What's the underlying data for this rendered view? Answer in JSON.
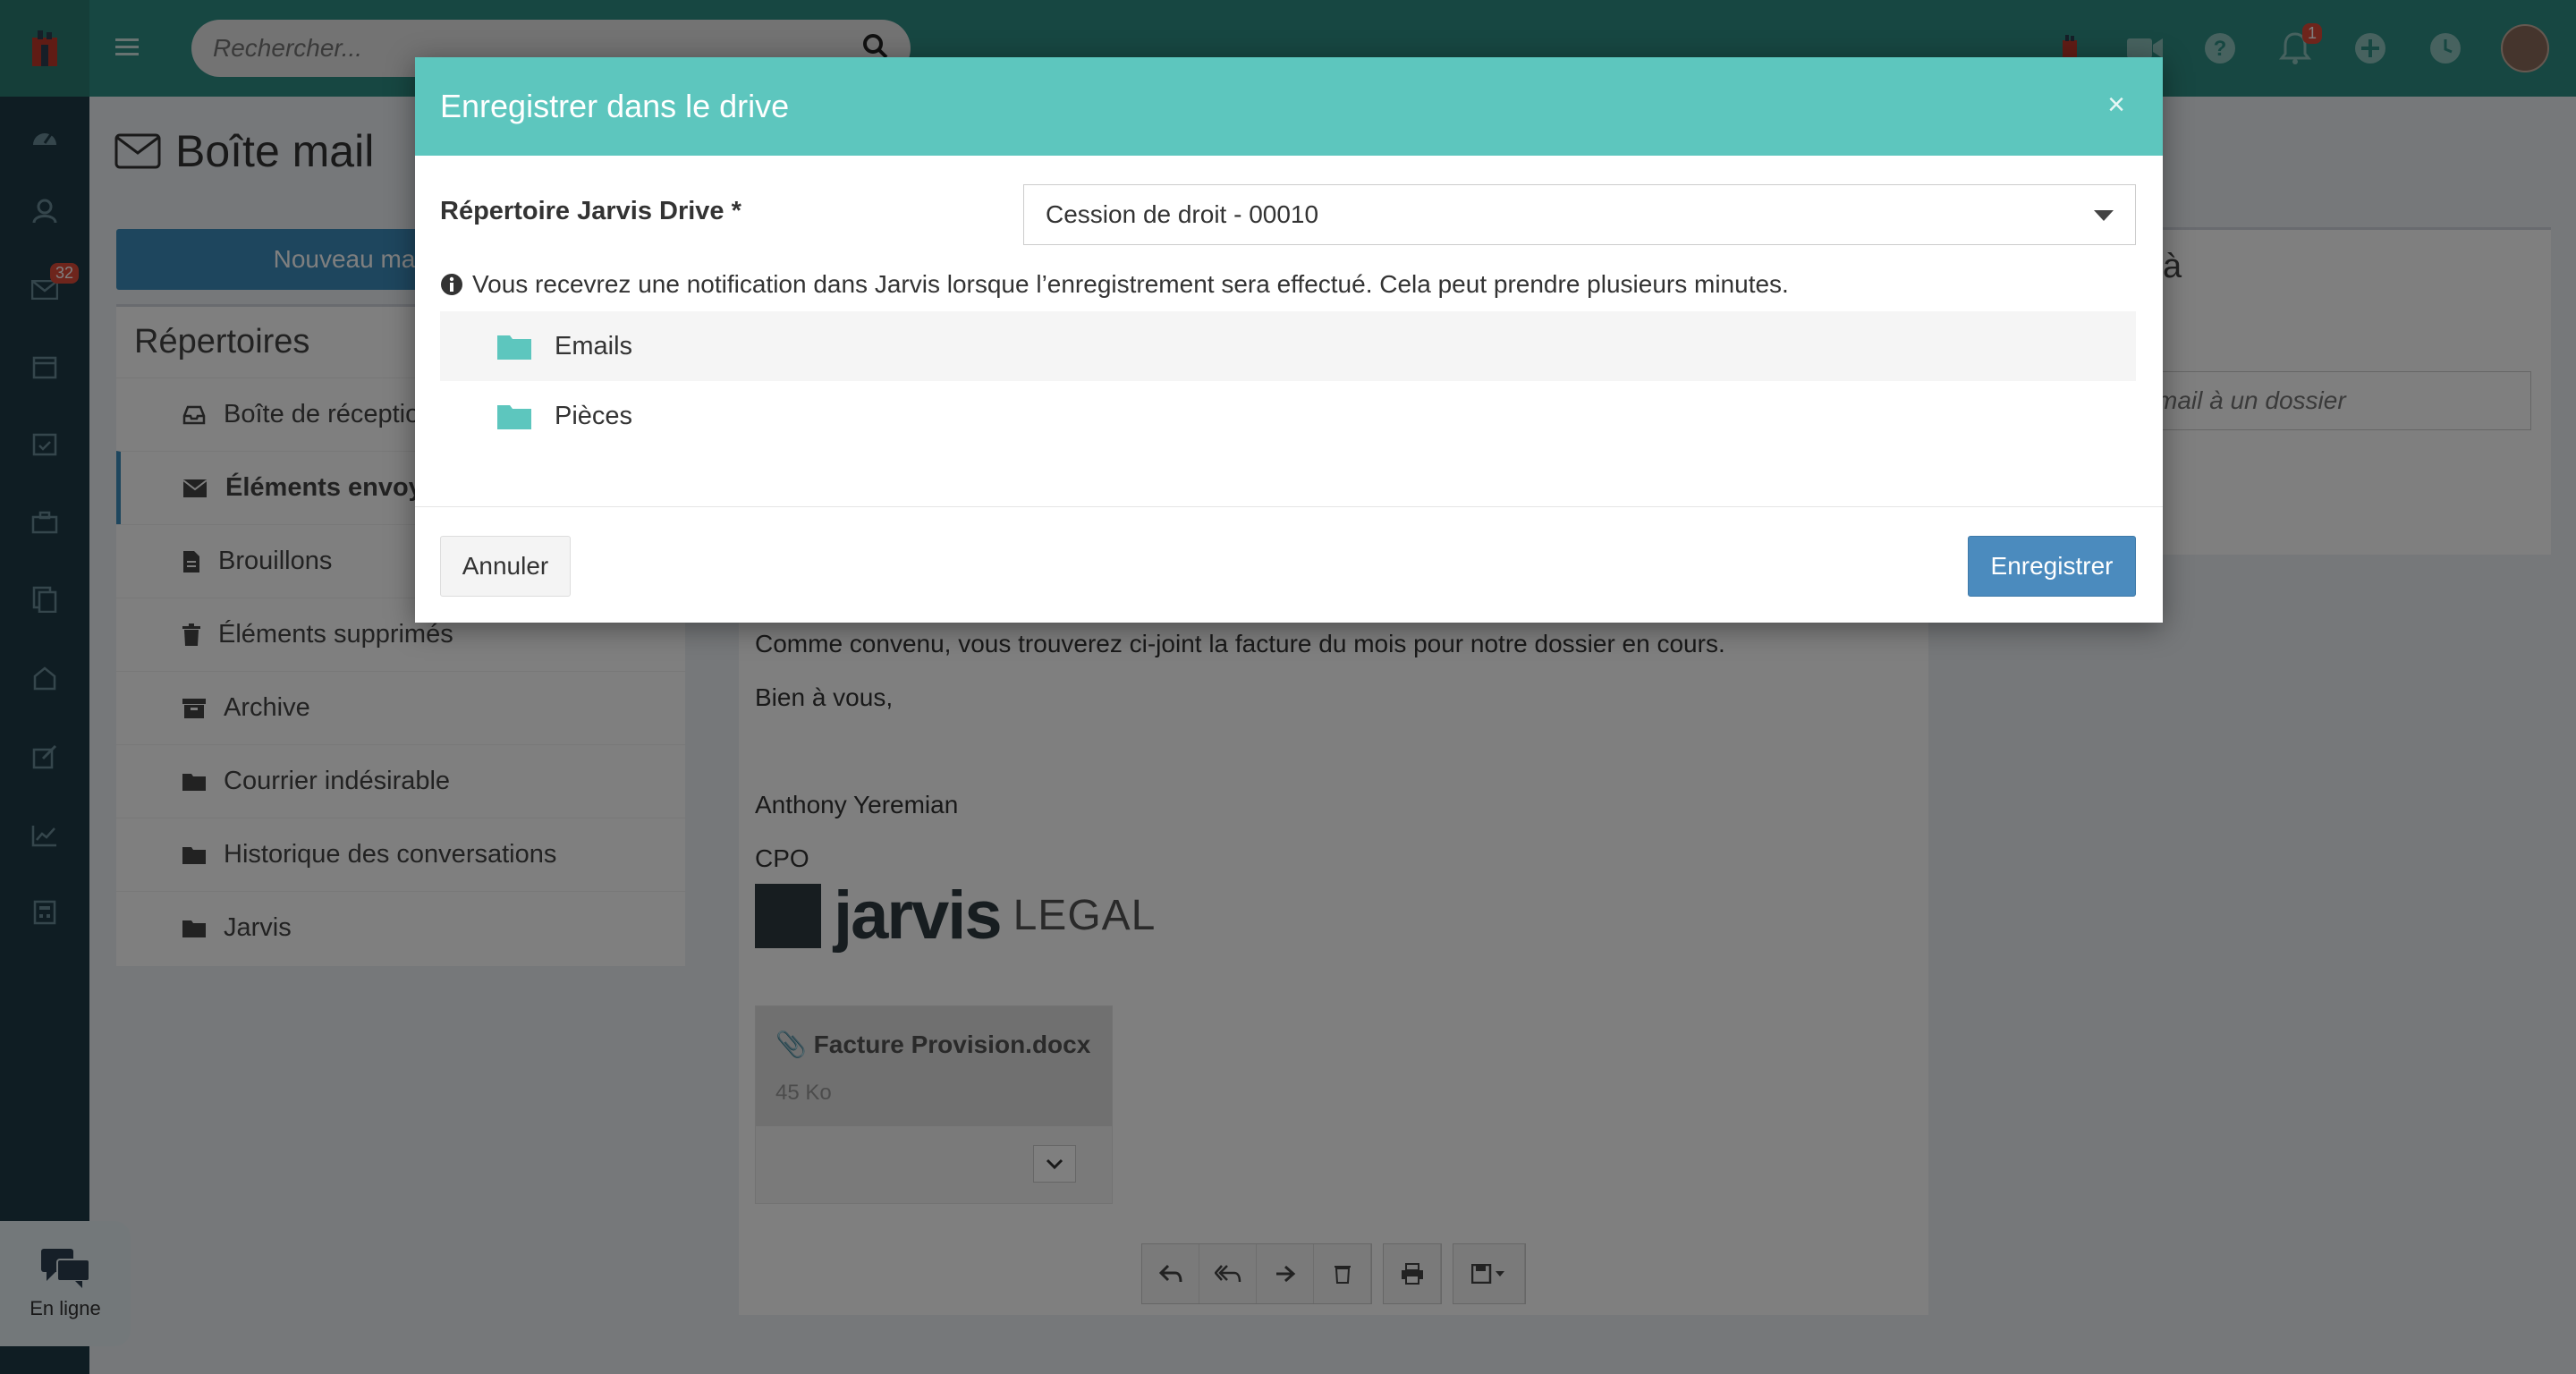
{
  "topbar": {
    "search_placeholder": "Rechercher...",
    "notification_count": "1",
    "icons": [
      "app-logo",
      "menu-icon",
      "search-icon",
      "device-icon",
      "video-icon",
      "help-icon",
      "bell-icon",
      "plus-circle-icon",
      "clock-icon",
      "avatar"
    ]
  },
  "sidebar": {
    "mail_badge": "32",
    "icons": [
      "dashboard-icon",
      "contacts-icon",
      "mail-icon",
      "calendar-icon",
      "tasks-icon",
      "briefcase-icon",
      "documents-icon",
      "billing-icon",
      "edit-icon",
      "chart-icon",
      "calculator-icon"
    ]
  },
  "chat": {
    "label": "En ligne"
  },
  "page": {
    "title": "Boîte mail",
    "new_mail_button": "Nouveau ma"
  },
  "folders": {
    "title": "Répertoires",
    "items": [
      {
        "label": "Boîte de réceptio",
        "icon": "inbox-icon"
      },
      {
        "label": "Éléments envoy",
        "icon": "envelope-icon"
      },
      {
        "label": "Brouillons",
        "icon": "file-icon"
      },
      {
        "label": "Éléments supprimés",
        "icon": "trash-icon"
      },
      {
        "label": "Archive",
        "icon": "archive-icon"
      },
      {
        "label": "Courrier indésirable",
        "icon": "folder-icon"
      },
      {
        "label": "Historique des conversations",
        "icon": "folder-icon"
      },
      {
        "label": "Jarvis",
        "icon": "folder-icon"
      }
    ]
  },
  "mail": {
    "body_line_1": "Comme convenu, vous trouverez ci-joint la facture du mois pour notre dossier en cours.",
    "body_line_2": "Bien à vous,",
    "signature_name": "Anthony Yeremian",
    "signature_title": "CPO",
    "logo_text": "jarvis",
    "logo_suffix": "LEGAL",
    "attachment": {
      "name": "Facture Provision.docx",
      "size": "45 Ko"
    }
  },
  "right_panel": {
    "title": "à",
    "input_placeholder": "mail à un dossier"
  },
  "modal": {
    "title": "Enregistrer dans le drive",
    "close_label": "×",
    "field_label": "Répertoire Jarvis Drive *",
    "selected_value": "Cession de droit - 00010",
    "info_text": "Vous recevrez une notification dans Jarvis lorsque l’enregistrement sera effectué. Cela peut prendre plusieurs minutes.",
    "tree": [
      "Emails",
      "Pièces"
    ],
    "cancel_button": "Annuler",
    "save_button": "Enregistrer"
  },
  "colors": {
    "topbar": "#2f8f85",
    "sidebar": "#1f3a46",
    "modal_header": "#5dc6be",
    "primary_button": "#4b8bbe",
    "folder_icon": "#5dc6be"
  }
}
